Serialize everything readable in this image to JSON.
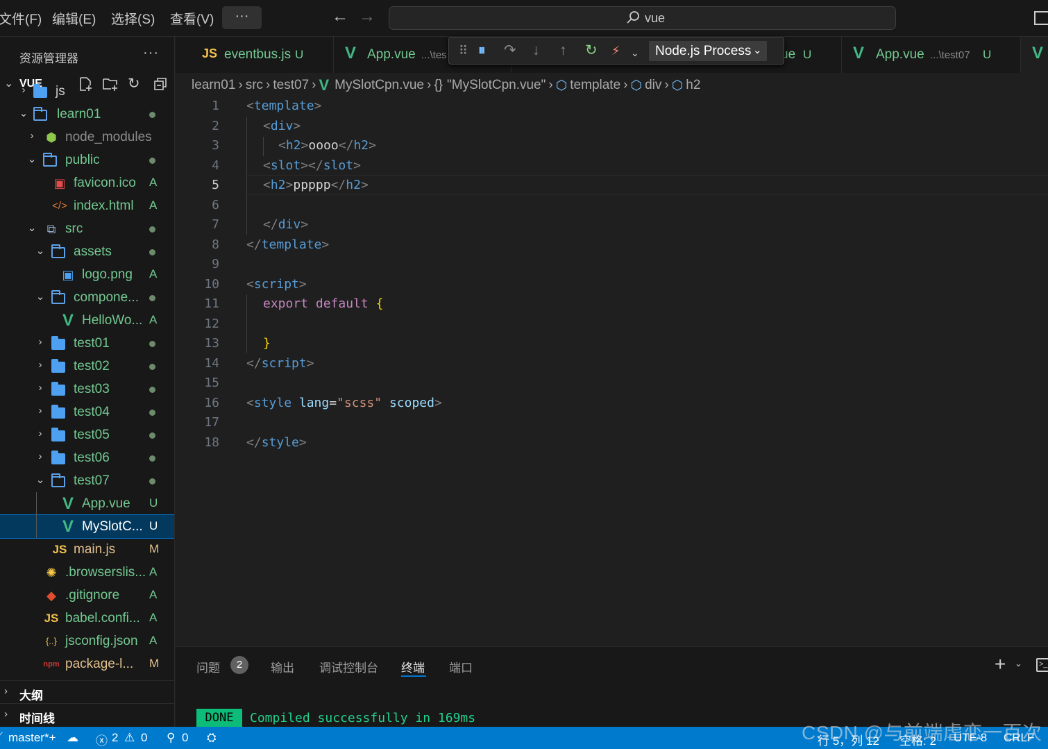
{
  "menu": {
    "file": "文件(F)",
    "edit": "编辑(E)",
    "selection": "选择(S)",
    "view": "查看(V)",
    "more": "···"
  },
  "command_center": {
    "text": "vue"
  },
  "sidebar": {
    "title": "资源管理器",
    "more": "···",
    "root_label": "VUE",
    "tree": [
      {
        "label": "js",
        "type": "folder-closed",
        "status": ""
      },
      {
        "label": "learn01",
        "type": "folder-open",
        "status": "dot"
      },
      {
        "label": "node_modules",
        "type": "node",
        "status": ""
      },
      {
        "label": "public",
        "type": "folder-open",
        "status": "dot"
      },
      {
        "label": "favicon.ico",
        "type": "image-red",
        "status": "A"
      },
      {
        "label": "index.html",
        "type": "html",
        "status": "A"
      },
      {
        "label": "src",
        "type": "src",
        "status": "dot"
      },
      {
        "label": "assets",
        "type": "folder-open",
        "status": "dot"
      },
      {
        "label": "logo.png",
        "type": "image",
        "status": "A"
      },
      {
        "label": "compone...",
        "type": "folder-open",
        "status": "dot"
      },
      {
        "label": "HelloWo...",
        "type": "vue",
        "status": "A"
      },
      {
        "label": "test01",
        "type": "folder-closed",
        "status": "dot"
      },
      {
        "label": "test02",
        "type": "folder-closed",
        "status": "dot"
      },
      {
        "label": "test03",
        "type": "folder-closed",
        "status": "dot"
      },
      {
        "label": "test04",
        "type": "folder-closed",
        "status": "dot"
      },
      {
        "label": "test05",
        "type": "folder-closed",
        "status": "dot"
      },
      {
        "label": "test06",
        "type": "folder-closed",
        "status": "dot"
      },
      {
        "label": "test07",
        "type": "folder-open",
        "status": "dot"
      },
      {
        "label": "App.vue",
        "type": "vue",
        "status": "U"
      },
      {
        "label": "MySlotC...",
        "type": "vue",
        "status": "U"
      },
      {
        "label": "main.js",
        "type": "js",
        "status": "M"
      },
      {
        "label": ".browserslis...",
        "type": "browserslist",
        "status": "A"
      },
      {
        "label": ".gitignore",
        "type": "git",
        "status": "A"
      },
      {
        "label": "babel.confi...",
        "type": "js",
        "status": "A"
      },
      {
        "label": "jsconfig.json",
        "type": "json",
        "status": "A"
      },
      {
        "label": "package-l...",
        "type": "npm",
        "status": "M"
      }
    ],
    "outline_label": "大纲",
    "timeline_label": "时间线"
  },
  "tabs": [
    {
      "icon": "JS",
      "name": "eventbus.js",
      "path": "",
      "status": "U"
    },
    {
      "icon": "V",
      "name": "App.vue",
      "path": "...\\tes",
      "status": ""
    },
    {
      "icon": "",
      "name": "ue",
      "path": "",
      "status": "U"
    },
    {
      "icon": "V",
      "name": "App.vue",
      "path": "...\\test07",
      "status": "U"
    },
    {
      "icon": "V",
      "name": "",
      "path": "",
      "status": ""
    }
  ],
  "debug": {
    "session": "Node.js Process"
  },
  "breadcrumb": {
    "p1": "learn01",
    "p2": "src",
    "p3": "test07",
    "p4": "MySlotCpn.vue",
    "p5": "\"MySlotCpn.vue\"",
    "p6": "template",
    "p7": "div",
    "p8": "h2"
  },
  "editor": {
    "line_numbers": [
      "1",
      "2",
      "3",
      "4",
      "5",
      "6",
      "7",
      "8",
      "9",
      "10",
      "11",
      "12",
      "13",
      "14",
      "15",
      "16",
      "17",
      "18"
    ],
    "active_line": 5,
    "code": {
      "template_tag": "template",
      "div_tag": "div",
      "h2_tag": "h2",
      "h2_text_1": "oooo",
      "slot_tag": "slot",
      "h2_text_2": "ppppp",
      "script_tag": "script",
      "export_kw": "export",
      "default_kw": "default",
      "open_brace": "{",
      "close_brace": "}",
      "style_tag": "style",
      "lang_attr": "lang",
      "lang_value": "\"scss\"",
      "scoped_attr": "scoped"
    }
  },
  "panel": {
    "tabs": [
      "问题",
      "输出",
      "调试控制台",
      "终端",
      "端口"
    ],
    "active_tab": "终端",
    "problems_count": "2",
    "done_label": "DONE",
    "terminal_message": "Compiled successfully in 169ms"
  },
  "statusbar": {
    "branch": "master*+",
    "errors": "2",
    "warnings": "0",
    "ports": "0",
    "position": "行 5，列 12",
    "spaces": "空格: 2",
    "encoding": "UTF-8",
    "eol": "CRLF"
  },
  "watermark": "CSDN @与前端虐恋一百次",
  "colors": {
    "accent": "#007acc",
    "added": "#73c991",
    "modified": "#e2c08d",
    "vue_green": "#41b883",
    "js_yellow": "#f1c04d",
    "done_green": "#0dbc79"
  }
}
